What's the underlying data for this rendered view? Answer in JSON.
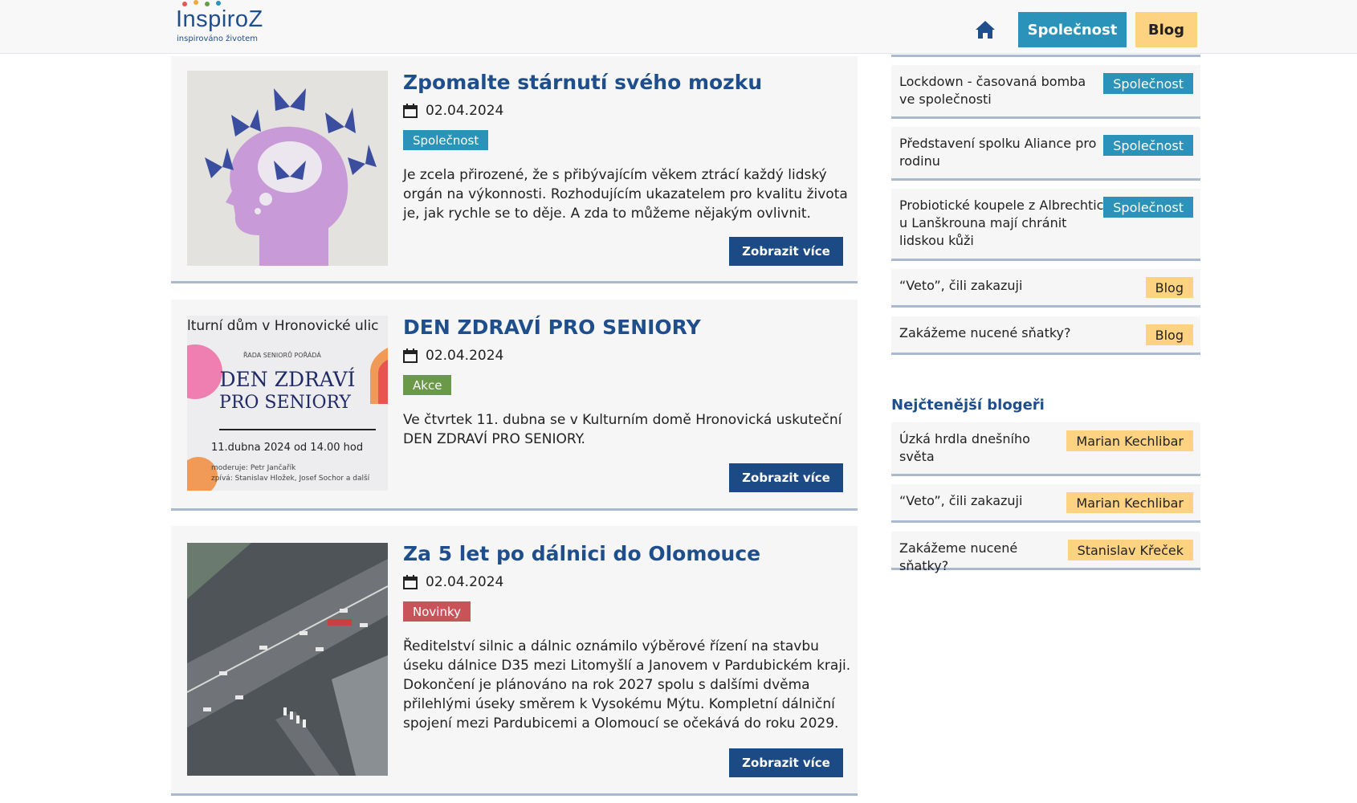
{
  "header": {
    "logo_text": "InspiroZ",
    "logo_tagline": "inspirováno životem",
    "home_icon": "home-icon",
    "nav": {
      "spolecnost": "Společnost",
      "blog": "Blog"
    }
  },
  "colors": {
    "primary": "#1f4e8c",
    "spolecnost": "#2b93b9",
    "blog": "#fdd281",
    "akce": "#6a9a47",
    "novinky": "#c8545a",
    "button": "#1c4a84"
  },
  "articles": [
    {
      "title": "Zpomalte stárnutí svého mozku",
      "date": "02.04.2024",
      "category": "Společnost",
      "text": "Je zcela přirozené, že s přibývajícím věkem ztrácí každý lidský orgán na výkonnosti. Rozhodujícím ukazatelem pro kvalitu života je, jak rychle se to děje. A zda to můžeme nějakým ovlivnit.",
      "button": "Zobrazit více"
    },
    {
      "title": "DEN ZDRAVÍ PRO SENIORY",
      "date": "02.04.2024",
      "category": "Akce",
      "text": "Ve čtvrtek 11. dubna se v Kulturním domě Hronovická uskuteční DEN ZDRAVÍ PRO SENIORY.",
      "button": "Zobrazit více",
      "image_text": {
        "top": "lturní dům v Hronovické ulic",
        "small": "ŘADA SENIORŮ POŘÁDÁ",
        "line1": "DEN ZDRAVÍ",
        "line2": "PRO SENIORY",
        "date": "11.dubna 2024 od 14.00 hod",
        "mod": "moderuje: Petr Jančařík",
        "sing": "zpívá: Stanislav Hložek, Josef Sochor a další"
      }
    },
    {
      "title": "Za 5 let po dálnici do Olomouce",
      "date": "02.04.2024",
      "category": "Novinky",
      "text": "Ředitelství silnic a dálnic oznámilo výběrové řízení na stavbu úseku dálnice D35 mezi Litomyšlí a Janovem v Pardubickém kraji. Dokončení je plánováno na rok 2027 spolu s dalšími dvěma přilehlými úseky směrem k Vysokému Mýtu. Kompletní dálniční spojení mezi Pardubicemi a Olomoucí se očekává do roku 2029.",
      "button": "Zobrazit více"
    }
  ],
  "sidebar": {
    "latest": [
      {
        "title": "Lockdown - časovaná bomba ve společnosti",
        "tag": "Společnost"
      },
      {
        "title": "Představení spolku Aliance pro rodinu",
        "tag": "Společnost"
      },
      {
        "title": "Probiotické koupele z Albrechtic u Lanškrouna mají chránit lidskou kůži",
        "tag": "Společnost"
      },
      {
        "title": "“Veto”, čili zakazuji",
        "tag": "Blog"
      },
      {
        "title": "Zakážeme nucené sňatky?",
        "tag": "Blog"
      }
    ],
    "bloggers_title": "Nejčtenější blogeři",
    "bloggers": [
      {
        "title": "Úzká hrdla dnešního světa",
        "author": "Marian Kechlibar"
      },
      {
        "title": "“Veto”, čili zakazuji",
        "author": "Marian Kechlibar"
      },
      {
        "title": "Zakážeme nucené sňatky?",
        "author": "Stanislav Křeček"
      }
    ]
  }
}
